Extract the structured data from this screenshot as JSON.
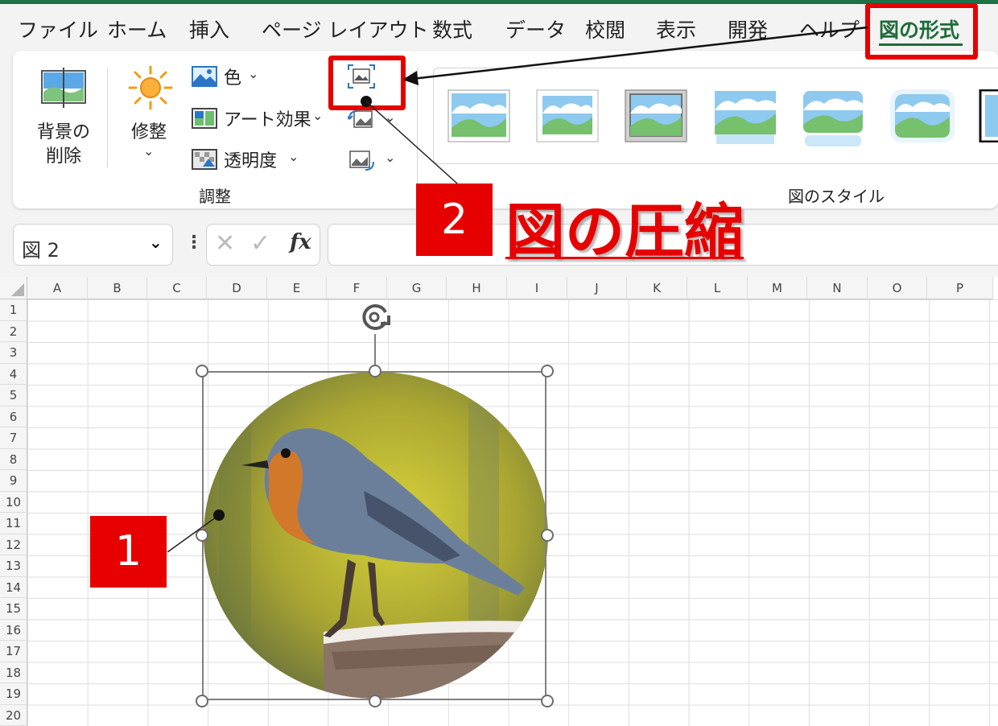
{
  "menu": {
    "tabs": [
      "ファイル",
      "ホーム",
      "挿入",
      "ページ レイアウト",
      "数式",
      "データ",
      "校閲",
      "表示",
      "開発",
      "ヘルプ"
    ],
    "active_tab": "図の形式"
  },
  "ribbon": {
    "remove_background": [
      "背景の",
      "削除"
    ],
    "corrections": "修整",
    "color": "色",
    "artistic_effects": "アート効果",
    "transparency": "透明度",
    "adjust_group": "調整",
    "styles_group": "図のスタイル"
  },
  "formula": {
    "name_box": "図 2",
    "fx": "fx"
  },
  "sheet": {
    "columns": [
      "A",
      "B",
      "C",
      "D",
      "E",
      "F",
      "G",
      "H",
      "I",
      "J",
      "K",
      "L",
      "M",
      "N",
      "O",
      "P"
    ],
    "rows": [
      "1",
      "2",
      "3",
      "4",
      "5",
      "6",
      "7",
      "8",
      "9",
      "10",
      "11",
      "12",
      "13",
      "14",
      "15",
      "16",
      "17",
      "18",
      "19",
      "20"
    ]
  },
  "annotations": {
    "step1": "1",
    "step2": "2",
    "step2_label": "図の圧縮"
  },
  "colors": {
    "excel_green": "#1e7145",
    "highlight_red": "#e60000"
  }
}
